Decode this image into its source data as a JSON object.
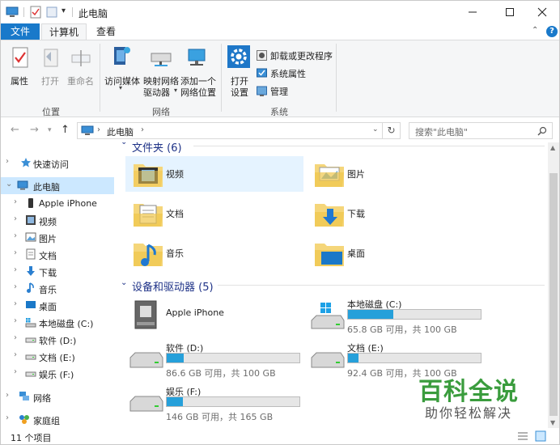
{
  "window": {
    "title": "此电脑"
  },
  "ribbon": {
    "tabs": [
      "文件",
      "计算机",
      "查看"
    ],
    "location": {
      "group": "位置",
      "properties": "属性",
      "open": "打开",
      "rename": "重命名"
    },
    "network": {
      "group": "网络",
      "media_1": "访问媒体",
      "map_1": "映射网络",
      "map_2": "驱动器",
      "add_1": "添加一个",
      "add_2": "网络位置"
    },
    "system": {
      "group": "系统",
      "settings_1": "打开",
      "settings_2": "设置",
      "uninstall": "卸载或更改程序",
      "sys_props": "系统属性",
      "manage": "管理"
    }
  },
  "address": {
    "path": "此电脑",
    "search_placeholder": "搜索\"此电脑\""
  },
  "nav": {
    "items": [
      {
        "label": "快速访问",
        "icon": "star-icon"
      },
      {
        "label": "此电脑",
        "icon": "computer-icon"
      },
      {
        "label": "Apple iPhone",
        "icon": "phone-icon"
      },
      {
        "label": "视频",
        "icon": "video-icon"
      },
      {
        "label": "图片",
        "icon": "picture-icon"
      },
      {
        "label": "文档",
        "icon": "document-icon"
      },
      {
        "label": "下载",
        "icon": "download-icon"
      },
      {
        "label": "音乐",
        "icon": "music-icon"
      },
      {
        "label": "桌面",
        "icon": "desktop-icon"
      },
      {
        "label": "本地磁盘 (C:)",
        "icon": "disk-icon"
      },
      {
        "label": "软件 (D:)",
        "icon": "drive-icon"
      },
      {
        "label": "文档 (E:)",
        "icon": "drive-icon"
      },
      {
        "label": "娱乐 (F:)",
        "icon": "drive-icon"
      },
      {
        "label": "网络",
        "icon": "network-icon"
      },
      {
        "label": "家庭组",
        "icon": "homegroup-icon"
      }
    ]
  },
  "folders": {
    "header": "文件夹 (6)",
    "items": [
      {
        "label": "视频",
        "icon": "video-folder-icon"
      },
      {
        "label": "图片",
        "icon": "picture-folder-icon"
      },
      {
        "label": "文档",
        "icon": "document-folder-icon"
      },
      {
        "label": "下载",
        "icon": "download-folder-icon"
      },
      {
        "label": "音乐",
        "icon": "music-folder-icon"
      },
      {
        "label": "桌面",
        "icon": "desktop-folder-icon"
      }
    ]
  },
  "devices": {
    "header": "设备和驱动器 (5)",
    "items": [
      {
        "name": "Apple iPhone",
        "free": "",
        "used": null
      },
      {
        "name": "本地磁盘 (C:)",
        "free": "65.8 GB 可用，共 100 GB",
        "used": 0.34
      },
      {
        "name": "软件 (D:)",
        "free": "86.6 GB 可用，共 100 GB",
        "used": 0.13
      },
      {
        "name": "文档 (E:)",
        "free": "92.4 GB 可用，共 100 GB",
        "used": 0.08
      },
      {
        "name": "娱乐 (F:)",
        "free": "146 GB 可用，共 165 GB",
        "used": 0.12
      }
    ]
  },
  "status": {
    "count": "11 个项目"
  },
  "watermark": {
    "title": "百科全说",
    "subtitle": "助你轻松解决"
  }
}
